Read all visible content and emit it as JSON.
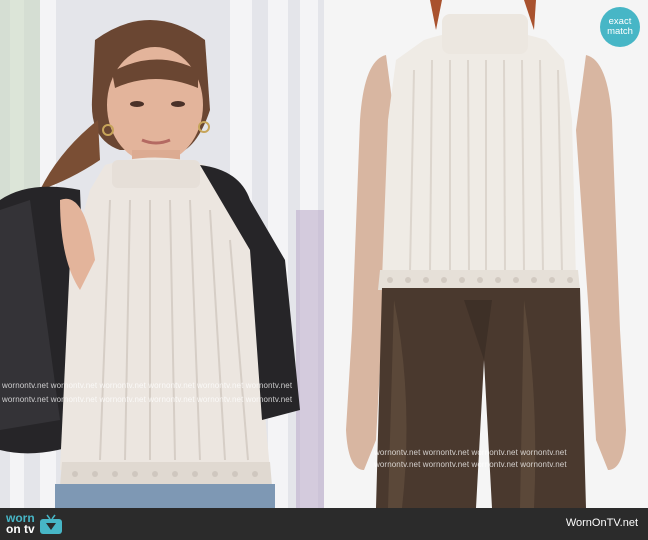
{
  "badge": {
    "line1": "exact",
    "line2": "match"
  },
  "watermark": {
    "text": "wornontv.net",
    "left_rows": [
      [
        "wornontv.net",
        "wornontv.net",
        "wornontv.net",
        "wornontv.net",
        "wornontv.net",
        "wornontv.net"
      ],
      [
        "wornontv.net",
        "wornontv.net",
        "wornontv.net",
        "wornontv.net",
        "wornontv.net",
        "wornontv.net"
      ]
    ],
    "right_rows": [
      [
        "wornontv.net",
        "wornontv.net",
        "wornontv.net",
        "wornontv.net"
      ],
      [
        "wornontv.net",
        "wornontv.net",
        "wornontv.net",
        "wornontv.net"
      ]
    ]
  },
  "footer": {
    "logo_line1": "worn",
    "logo_line2": "on tv",
    "site_name": "WornOnTV.net"
  },
  "colors": {
    "accent": "#47b6c6",
    "footer_bg": "#2b2b2b"
  }
}
